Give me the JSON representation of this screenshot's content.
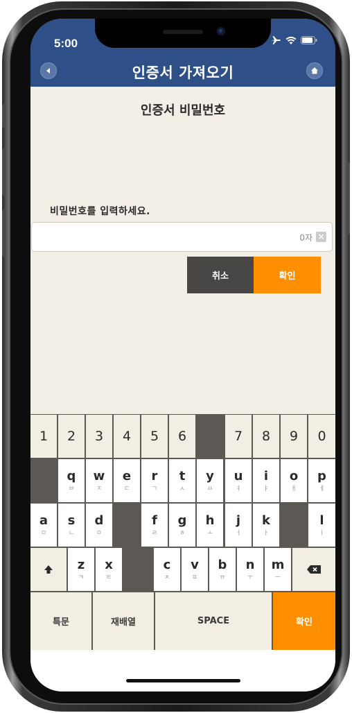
{
  "status": {
    "time": "5:00"
  },
  "header": {
    "title": "인증서 가져오기"
  },
  "content": {
    "section_title": "인증서 비밀번호",
    "prompt": "비밀번호를 입력하세요.",
    "input": {
      "value": "",
      "char_count": "0자"
    },
    "cancel_label": "취소",
    "confirm_label": "확인"
  },
  "keyboard": {
    "number_row": [
      "1",
      "2",
      "3",
      "4",
      "5",
      "6",
      "",
      "7",
      "8",
      "9",
      "0"
    ],
    "row2": [
      {
        "main": "",
        "sub": ""
      },
      {
        "main": "q",
        "sub": "ㅂ"
      },
      {
        "main": "w",
        "sub": "ㅈ"
      },
      {
        "main": "e",
        "sub": "ㄷ"
      },
      {
        "main": "r",
        "sub": "ㄱ"
      },
      {
        "main": "t",
        "sub": "ㅅ"
      },
      {
        "main": "y",
        "sub": "ㅛ"
      },
      {
        "main": "u",
        "sub": "ㅕ"
      },
      {
        "main": "i",
        "sub": "ㅑ"
      },
      {
        "main": "o",
        "sub": "ㅐ"
      },
      {
        "main": "p",
        "sub": "ㅔ"
      }
    ],
    "row3": [
      {
        "main": "a",
        "sub": "ㅁ"
      },
      {
        "main": "s",
        "sub": "ㄴ"
      },
      {
        "main": "d",
        "sub": "ㅇ"
      },
      {
        "main": "",
        "sub": ""
      },
      {
        "main": "f",
        "sub": "ㄹ"
      },
      {
        "main": "g",
        "sub": "ㅎ"
      },
      {
        "main": "h",
        "sub": "ㅗ"
      },
      {
        "main": "j",
        "sub": "ㅓ"
      },
      {
        "main": "k",
        "sub": "ㅏ"
      },
      {
        "main": "",
        "sub": ""
      },
      {
        "main": "l",
        "sub": "ㅣ"
      }
    ],
    "row4": [
      {
        "main": "z",
        "sub": "ㅋ"
      },
      {
        "main": "x",
        "sub": "ㅌ"
      },
      {
        "main": "c",
        "sub": "ㅊ"
      },
      {
        "main": "v",
        "sub": "ㅍ"
      },
      {
        "main": "b",
        "sub": "ㅠ"
      },
      {
        "main": "n",
        "sub": "ㅜ"
      },
      {
        "main": "m",
        "sub": "ㅡ"
      }
    ],
    "special_label": "특문",
    "shuffle_label": "재배열",
    "space_label": "SPACE",
    "confirm_label": "확인",
    "shift_icon": "shift-arrow-icon",
    "backspace_icon": "backspace-icon"
  },
  "colors": {
    "header": "#2e4f87",
    "accent": "#ff8f00",
    "cancel": "#484745",
    "background": "#f4efe6"
  }
}
